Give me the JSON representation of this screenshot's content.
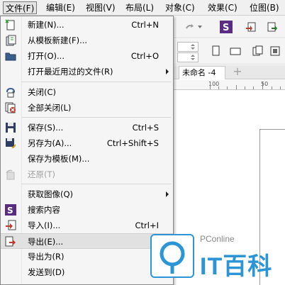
{
  "menubar": {
    "items": [
      {
        "label": "文件(F)"
      },
      {
        "label": "编辑(E)"
      },
      {
        "label": "视图(V)"
      },
      {
        "label": "布局(L)"
      },
      {
        "label": "对象(C)"
      },
      {
        "label": "效果(C)"
      },
      {
        "label": "位图(B)"
      }
    ]
  },
  "document": {
    "tab_label": "未命名 -4",
    "add_tab_label": "+"
  },
  "ruler": {
    "label_100": "100",
    "label_50": "50"
  },
  "file_menu": {
    "items": [
      {
        "label": "新建(N)...",
        "shortcut": "Ctrl+N",
        "icon": "new-document-icon"
      },
      {
        "label": "从模板新建(F)...",
        "shortcut": "",
        "icon": "new-from-template-icon"
      },
      {
        "label": "打开(O)...",
        "shortcut": "Ctrl+O",
        "icon": "folder-open-icon"
      },
      {
        "label": "打开最近用过的文件(R)",
        "shortcut": "",
        "icon": "",
        "submenu": true
      },
      {
        "label": "关闭(C)",
        "shortcut": "",
        "icon": "close-document-icon"
      },
      {
        "label": "全部关闭(L)",
        "shortcut": "",
        "icon": "close-all-icon"
      },
      {
        "label": "保存(S)...",
        "shortcut": "Ctrl+S",
        "icon": "save-icon"
      },
      {
        "label": "另存为(A)...",
        "shortcut": "Ctrl+Shift+S",
        "icon": "save-as-icon"
      },
      {
        "label": "保存为模板(M)...",
        "shortcut": "",
        "icon": ""
      },
      {
        "label": "还原(T)",
        "shortcut": "",
        "icon": "revert-icon",
        "disabled": true
      },
      {
        "label": "获取图像(Q)",
        "shortcut": "",
        "icon": "",
        "submenu": true
      },
      {
        "label": "搜索内容",
        "shortcut": "",
        "icon": "content-search-icon"
      },
      {
        "label": "导入(I)...",
        "shortcut": "Ctrl+I",
        "icon": "import-icon"
      },
      {
        "label": "导出(E)...",
        "shortcut": "C",
        "icon": "export-icon",
        "highlighted": true
      },
      {
        "label": "导出为(R)",
        "shortcut": "",
        "icon": ""
      },
      {
        "label": "发送到(D)",
        "shortcut": "",
        "icon": ""
      }
    ]
  },
  "watermark": {
    "top_text": "PConline",
    "brand_text": "IT百科"
  },
  "colors": {
    "accent_blue": "#2b95d6",
    "corel_purple": "#5a2d82",
    "menu_bg": "#f5f5f5"
  }
}
